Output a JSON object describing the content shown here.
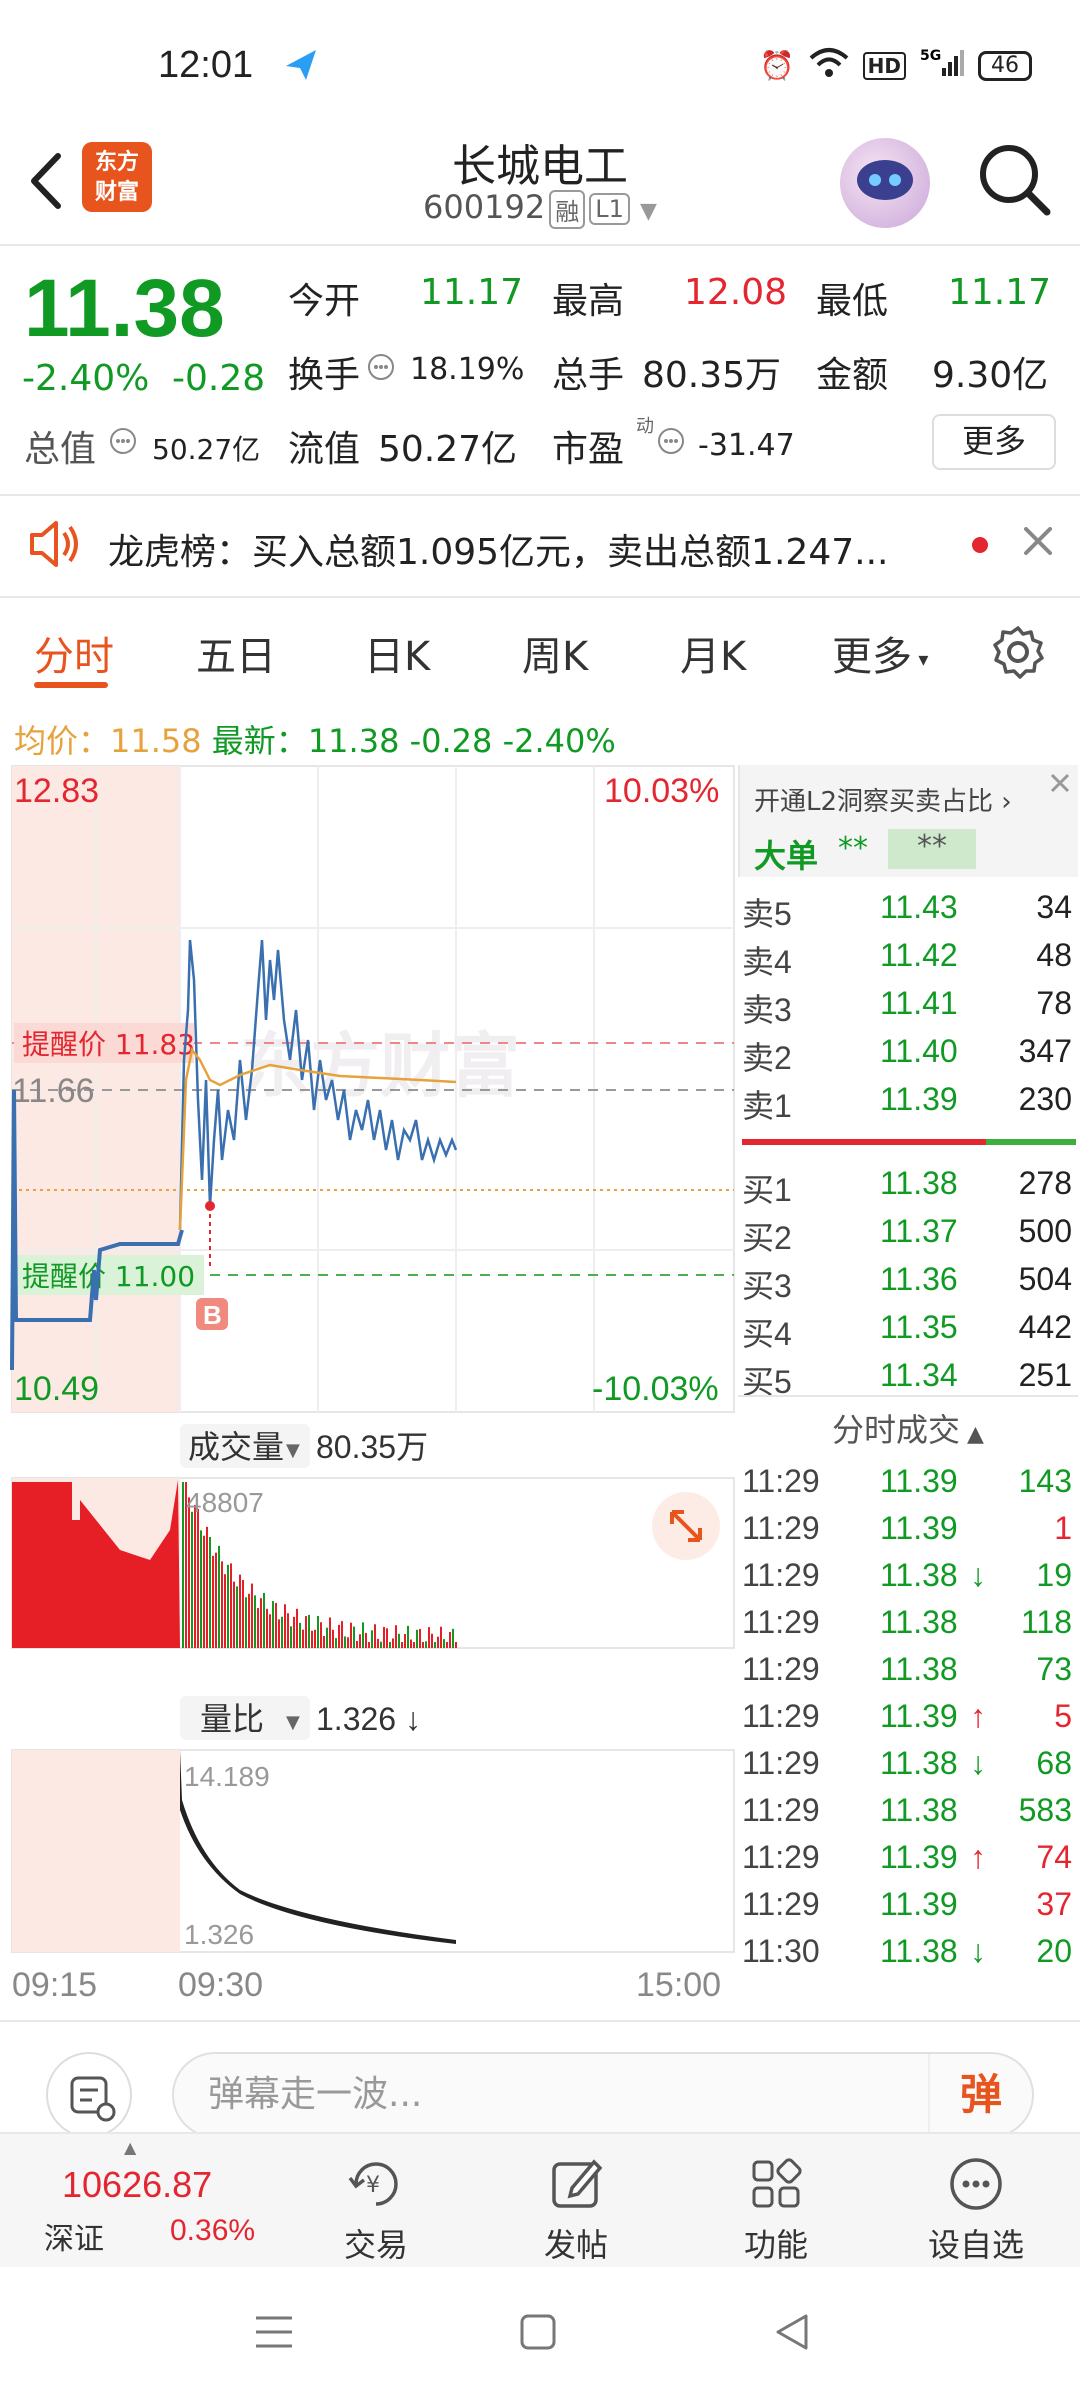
{
  "status_bar": {
    "time": "12:01",
    "battery": "46"
  },
  "header": {
    "title": "长城电工",
    "code": "600192",
    "tag_margin": "融",
    "tag_level": "L1",
    "logo_line1": "东方",
    "logo_line2": "财富"
  },
  "quote": {
    "price": "11.38",
    "change_pct": "-2.40%",
    "change": "-0.28",
    "open_label": "今开",
    "open": "11.17",
    "high_label": "最高",
    "high": "12.08",
    "low_label": "最低",
    "low": "11.17",
    "turnover_label": "换手",
    "turnover": "18.19%",
    "volume_label": "总手",
    "volume": "80.35万",
    "amount_label": "金额",
    "amount": "9.30亿",
    "mktcap_label": "总值",
    "mktcap": "50.27亿",
    "float_label": "流值",
    "float": "50.27亿",
    "pe_label": "市盈",
    "pe_sup": "动",
    "pe": "-31.47",
    "more_label": "更多"
  },
  "notice": {
    "text": "龙虎榜：买入总额1.095亿元，卖出总额1.247..."
  },
  "tabs": [
    "分时",
    "五日",
    "日K",
    "周K",
    "月K",
    "更多"
  ],
  "avg_line": {
    "avg_label": "均价：",
    "avg": "11.58",
    "latest_label": "最新：",
    "latest": "11.38",
    "chg": "-0.28",
    "pct": "-2.40%"
  },
  "chart": {
    "price_top": "12.83",
    "price_bottom": "10.49",
    "pct_top": "10.03%",
    "pct_bottom": "-10.03%",
    "ref_price": "11.66",
    "alert_high": "提醒价 11.83",
    "alert_low": "提醒价 11.00",
    "marker": "B",
    "volume_label": "成交量",
    "volume_value": "80.35万",
    "volume_max": "48807",
    "ratio_label": "量比",
    "ratio_value": "1.326 ↓",
    "ratio_max": "14.189",
    "ratio_min": "1.326",
    "time_start": "09:15",
    "time_mid": "09:30",
    "time_end": "15:00",
    "watermark": "东方财富"
  },
  "order_book": {
    "promo": "开通L2洞察买卖占比 ›",
    "big_order_label": "大单",
    "big_order_a": "**",
    "big_order_b": "**",
    "asks": [
      {
        "label": "卖5",
        "price": "11.43",
        "vol": "34"
      },
      {
        "label": "卖4",
        "price": "11.42",
        "vol": "48"
      },
      {
        "label": "卖3",
        "price": "11.41",
        "vol": "78"
      },
      {
        "label": "卖2",
        "price": "11.40",
        "vol": "347"
      },
      {
        "label": "卖1",
        "price": "11.39",
        "vol": "230"
      }
    ],
    "bids": [
      {
        "label": "买1",
        "price": "11.38",
        "vol": "278"
      },
      {
        "label": "买2",
        "price": "11.37",
        "vol": "500"
      },
      {
        "label": "买3",
        "price": "11.36",
        "vol": "504"
      },
      {
        "label": "买4",
        "price": "11.35",
        "vol": "442"
      },
      {
        "label": "买5",
        "price": "11.34",
        "vol": "251"
      }
    ],
    "ticks_title": "分时成交",
    "ticks": [
      {
        "time": "11:29",
        "price": "11.39",
        "dir": "",
        "vol": "143",
        "vcolor": "green"
      },
      {
        "time": "11:29",
        "price": "11.39",
        "dir": "",
        "vol": "1",
        "vcolor": "red"
      },
      {
        "time": "11:29",
        "price": "11.38",
        "dir": "↓",
        "vol": "19",
        "vcolor": "green"
      },
      {
        "time": "11:29",
        "price": "11.38",
        "dir": "",
        "vol": "118",
        "vcolor": "green"
      },
      {
        "time": "11:29",
        "price": "11.38",
        "dir": "",
        "vol": "73",
        "vcolor": "green"
      },
      {
        "time": "11:29",
        "price": "11.39",
        "dir": "↑",
        "vol": "5",
        "vcolor": "red"
      },
      {
        "time": "11:29",
        "price": "11.38",
        "dir": "↓",
        "vol": "68",
        "vcolor": "green"
      },
      {
        "time": "11:29",
        "price": "11.38",
        "dir": "",
        "vol": "583",
        "vcolor": "green"
      },
      {
        "time": "11:29",
        "price": "11.39",
        "dir": "↑",
        "vol": "74",
        "vcolor": "red"
      },
      {
        "time": "11:29",
        "price": "11.39",
        "dir": "",
        "vol": "37",
        "vcolor": "red"
      },
      {
        "time": "11:30",
        "price": "11.38",
        "dir": "↓",
        "vol": "20",
        "vcolor": "green"
      }
    ]
  },
  "danmu": {
    "placeholder": "弹幕走一波...",
    "button": "弹"
  },
  "nav": {
    "index_value": "10626.87",
    "index_name": "深证",
    "index_pct": "0.36%",
    "items": [
      "交易",
      "发帖",
      "功能",
      "设自选"
    ]
  },
  "colors": {
    "up": "#e3262f",
    "down": "#109a24",
    "accent": "#e8541e",
    "price_line": "#3a6fb0",
    "avg_line": "#e6a23c"
  }
}
